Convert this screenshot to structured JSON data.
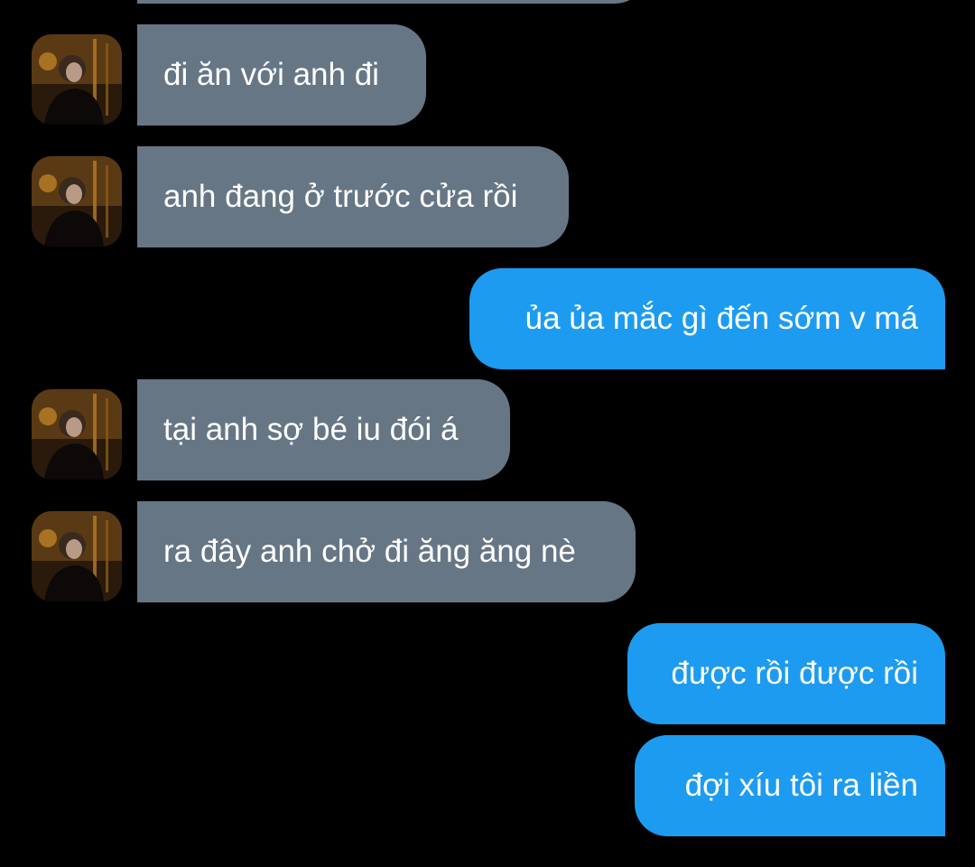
{
  "conversation": {
    "messages": [
      {
        "sender": "other",
        "text": "đi ăn với anh đi"
      },
      {
        "sender": "other",
        "text": "anh đang ở trước cửa rồi"
      },
      {
        "sender": "me",
        "text": "ủa ủa mắc gì đến sớm v má"
      },
      {
        "sender": "other",
        "text": "tại anh sợ bé iu đói á"
      },
      {
        "sender": "other",
        "text": "ra đây anh chở đi ăng ăng nè"
      },
      {
        "sender": "me",
        "text": "được rồi được rồi"
      },
      {
        "sender": "me",
        "text": "đợi xíu tôi ra liền"
      }
    ]
  },
  "avatar": {
    "icon": "profile-photo-avatar"
  },
  "colors": {
    "background": "#000000",
    "incoming_bubble": "#667685",
    "outgoing_bubble": "#1d9bf0",
    "text": "#ffffff"
  }
}
